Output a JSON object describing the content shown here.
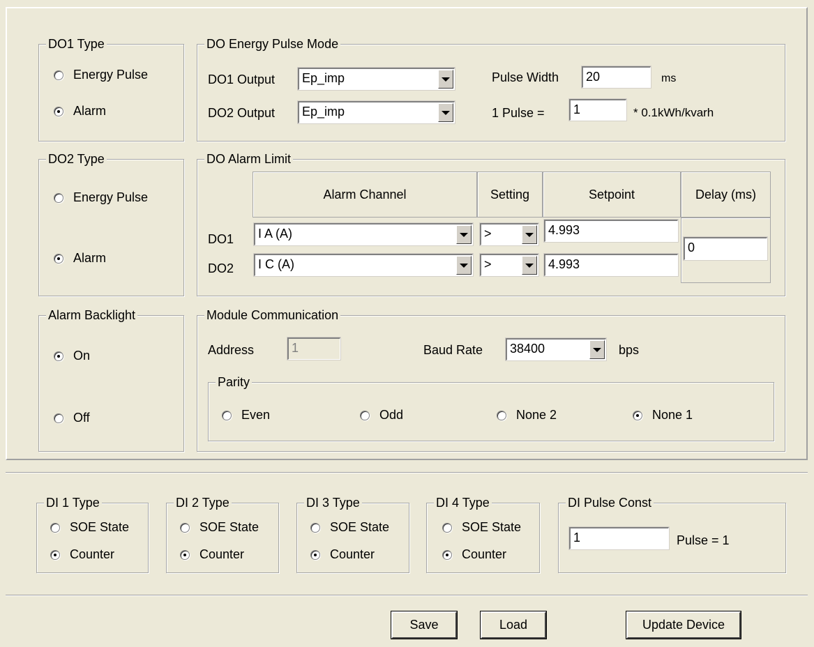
{
  "do1_type": {
    "title": "DO1 Type",
    "options": [
      "Energy Pulse",
      "Alarm"
    ],
    "selected": "Alarm"
  },
  "do2_type": {
    "title": "DO2 Type",
    "options": [
      "Energy Pulse",
      "Alarm"
    ],
    "selected": "Alarm"
  },
  "alarm_backlight": {
    "title": "Alarm Backlight",
    "options": [
      "On",
      "Off"
    ],
    "selected": "On"
  },
  "energy_pulse": {
    "title": "DO Energy Pulse Mode",
    "do1_label": "DO1 Output",
    "do1_value": "Ep_imp",
    "do2_label": "DO2 Output",
    "do2_value": "Ep_imp",
    "pulse_width_label": "Pulse Width",
    "pulse_width_value": "20",
    "pulse_width_unit": "ms",
    "pulse_label": "1 Pulse =",
    "pulse_value": "1",
    "pulse_unit": "* 0.1kWh/kvarh"
  },
  "alarm_limit": {
    "title": "DO Alarm Limit",
    "headers": [
      "Alarm Channel",
      "Setting",
      "Setpoint",
      "Delay (ms)"
    ],
    "rows": [
      {
        "label": "DO1",
        "channel": "I A (A)",
        "setting": ">",
        "setpoint": "4.993"
      },
      {
        "label": "DO2",
        "channel": "I C (A)",
        "setting": ">",
        "setpoint": "4.993"
      }
    ],
    "delay": "0"
  },
  "module_comm": {
    "title": "Module Communication",
    "address_label": "Address",
    "address_value": "1",
    "baud_label": "Baud Rate",
    "baud_value": "38400",
    "baud_unit": "bps",
    "parity": {
      "title": "Parity",
      "options": [
        "Even",
        "Odd",
        "None 2",
        "None 1"
      ],
      "selected": "None 1"
    }
  },
  "di_types": [
    {
      "title": "DI 1 Type",
      "options": [
        "SOE State",
        "Counter"
      ],
      "selected": "Counter"
    },
    {
      "title": "DI 2 Type",
      "options": [
        "SOE State",
        "Counter"
      ],
      "selected": "Counter"
    },
    {
      "title": "DI 3 Type",
      "options": [
        "SOE State",
        "Counter"
      ],
      "selected": "Counter"
    },
    {
      "title": "DI 4 Type",
      "options": [
        "SOE State",
        "Counter"
      ],
      "selected": "Counter"
    }
  ],
  "di_pulse": {
    "title": "DI Pulse Const",
    "value": "1",
    "unit": "Pulse = 1"
  },
  "buttons": {
    "save": "Save",
    "load": "Load",
    "update": "Update Device"
  }
}
